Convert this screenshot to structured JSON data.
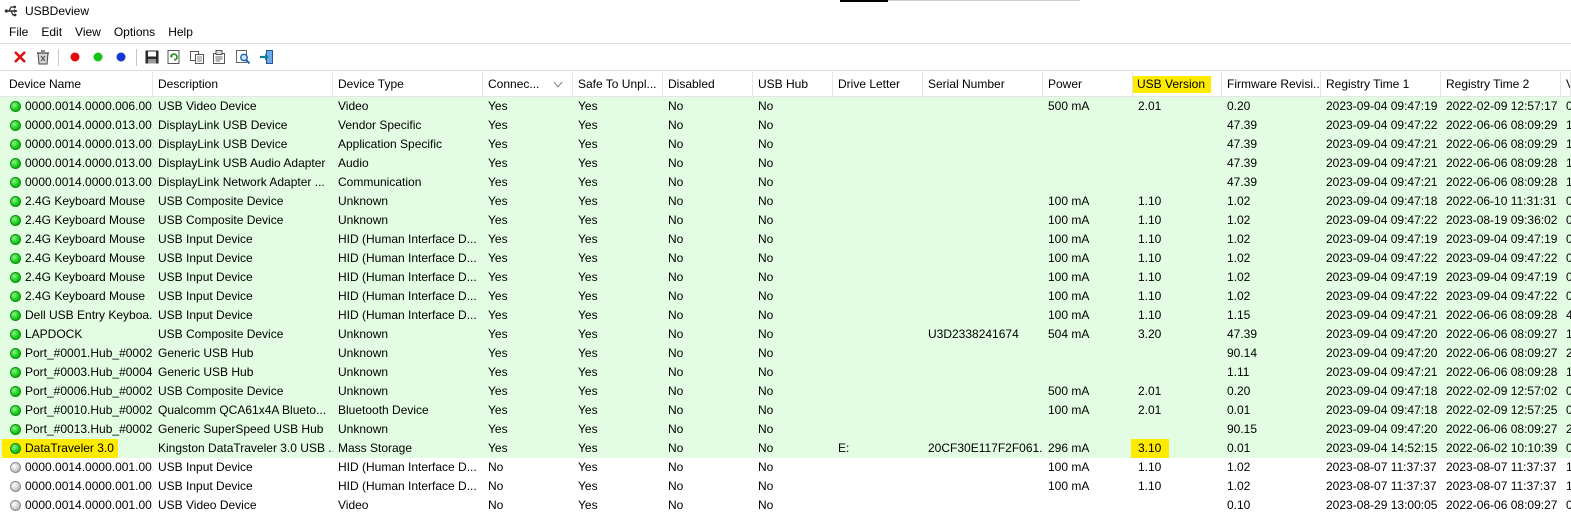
{
  "window": {
    "title": "USBDeview"
  },
  "menu": [
    "File",
    "Edit",
    "View",
    "Options",
    "Help"
  ],
  "toolbar": {
    "buttons": [
      "delete-icon",
      "uninstall-icon",
      "red-dot-icon",
      "green-dot-icon",
      "blue-dot-icon",
      "save-icon",
      "refresh-icon",
      "copy-icon",
      "properties-icon",
      "find-icon",
      "exit-icon"
    ]
  },
  "columns": [
    "Device Name",
    "Description",
    "Device Type",
    "Connec...",
    "Safe To Unpl...",
    "Disabled",
    "USB Hub",
    "Drive Letter",
    "Serial Number",
    "Power",
    "USB Version",
    "Firmware Revisi...",
    "Registry Time 1",
    "Registry Time 2",
    "V"
  ],
  "highlight_color": "#ffeb00",
  "connected_row_color": "#e2fde2",
  "rows": [
    {
      "status": "connected",
      "cells": [
        "0000.0014.0000.006.00...",
        "USB Video Device",
        "Video",
        "Yes",
        "Yes",
        "No",
        "No",
        "",
        "",
        "500 mA",
        "2.01",
        "0.20",
        "2023-09-04 09:47:19",
        "2022-02-09 12:57:17",
        "0"
      ]
    },
    {
      "status": "connected",
      "cells": [
        "0000.0014.0000.013.00...",
        "DisplayLink USB Device",
        "Vendor Specific",
        "Yes",
        "Yes",
        "No",
        "No",
        "",
        "",
        "",
        "",
        "47.39",
        "2023-09-04 09:47:22",
        "2022-06-06 08:09:29",
        "1"
      ]
    },
    {
      "status": "connected",
      "cells": [
        "0000.0014.0000.013.00...",
        "DisplayLink USB Device",
        "Application Specific",
        "Yes",
        "Yes",
        "No",
        "No",
        "",
        "",
        "",
        "",
        "47.39",
        "2023-09-04 09:47:21",
        "2022-06-06 08:09:29",
        "1"
      ]
    },
    {
      "status": "connected",
      "cells": [
        "0000.0014.0000.013.00...",
        "DisplayLink USB Audio Adapter",
        "Audio",
        "Yes",
        "Yes",
        "No",
        "No",
        "",
        "",
        "",
        "",
        "47.39",
        "2023-09-04 09:47:21",
        "2022-06-06 08:09:28",
        "1"
      ]
    },
    {
      "status": "connected",
      "cells": [
        "0000.0014.0000.013.00...",
        "DisplayLink Network Adapter ...",
        "Communication",
        "Yes",
        "Yes",
        "No",
        "No",
        "",
        "",
        "",
        "",
        "47.39",
        "2023-09-04 09:47:21",
        "2022-06-06 08:09:28",
        "1"
      ]
    },
    {
      "status": "connected",
      "cells": [
        "2.4G Keyboard Mouse",
        "USB Composite Device",
        "Unknown",
        "Yes",
        "Yes",
        "No",
        "No",
        "",
        "",
        "100 mA",
        "1.10",
        "1.02",
        "2023-09-04 09:47:18",
        "2022-06-10 11:31:31",
        "0"
      ]
    },
    {
      "status": "connected",
      "cells": [
        "2.4G Keyboard Mouse",
        "USB Composite Device",
        "Unknown",
        "Yes",
        "Yes",
        "No",
        "No",
        "",
        "",
        "100 mA",
        "1.10",
        "1.02",
        "2023-09-04 09:47:22",
        "2023-08-19 09:36:02",
        "0"
      ]
    },
    {
      "status": "connected",
      "cells": [
        "2.4G Keyboard Mouse",
        "USB Input Device",
        "HID (Human Interface D...",
        "Yes",
        "Yes",
        "No",
        "No",
        "",
        "",
        "100 mA",
        "1.10",
        "1.02",
        "2023-09-04 09:47:19",
        "2023-09-04 09:47:19",
        "0"
      ]
    },
    {
      "status": "connected",
      "cells": [
        "2.4G Keyboard Mouse",
        "USB Input Device",
        "HID (Human Interface D...",
        "Yes",
        "Yes",
        "No",
        "No",
        "",
        "",
        "100 mA",
        "1.10",
        "1.02",
        "2023-09-04 09:47:22",
        "2023-09-04 09:47:22",
        "0"
      ]
    },
    {
      "status": "connected",
      "cells": [
        "2.4G Keyboard Mouse",
        "USB Input Device",
        "HID (Human Interface D...",
        "Yes",
        "Yes",
        "No",
        "No",
        "",
        "",
        "100 mA",
        "1.10",
        "1.02",
        "2023-09-04 09:47:19",
        "2023-09-04 09:47:19",
        "0"
      ]
    },
    {
      "status": "connected",
      "cells": [
        "2.4G Keyboard Mouse",
        "USB Input Device",
        "HID (Human Interface D...",
        "Yes",
        "Yes",
        "No",
        "No",
        "",
        "",
        "100 mA",
        "1.10",
        "1.02",
        "2023-09-04 09:47:22",
        "2023-09-04 09:47:22",
        "0"
      ]
    },
    {
      "status": "connected",
      "cells": [
        "Dell USB Entry Keyboa...",
        "USB Input Device",
        "HID (Human Interface D...",
        "Yes",
        "Yes",
        "No",
        "No",
        "",
        "",
        "100 mA",
        "1.10",
        "1.15",
        "2023-09-04 09:47:21",
        "2022-06-06 08:09:28",
        "4"
      ]
    },
    {
      "status": "connected",
      "cells": [
        "LAPDOCK",
        "USB Composite Device",
        "Unknown",
        "Yes",
        "Yes",
        "No",
        "No",
        "",
        "U3D2338241674",
        "504 mA",
        "3.20",
        "47.39",
        "2023-09-04 09:47:20",
        "2022-06-06 08:09:27",
        "1"
      ]
    },
    {
      "status": "connected",
      "cells": [
        "Port_#0001.Hub_#0002",
        "Generic USB Hub",
        "Unknown",
        "Yes",
        "Yes",
        "No",
        "No",
        "",
        "",
        "",
        "",
        "90.14",
        "2023-09-04 09:47:20",
        "2022-06-06 08:09:27",
        "2"
      ]
    },
    {
      "status": "connected",
      "cells": [
        "Port_#0003.Hub_#0004",
        "Generic USB Hub",
        "Unknown",
        "Yes",
        "Yes",
        "No",
        "No",
        "",
        "",
        "",
        "",
        "1.11",
        "2023-09-04 09:47:21",
        "2022-06-06 08:09:28",
        "1"
      ]
    },
    {
      "status": "connected",
      "cells": [
        "Port_#0006.Hub_#0002",
        "USB Composite Device",
        "Unknown",
        "Yes",
        "Yes",
        "No",
        "No",
        "",
        "",
        "500 mA",
        "2.01",
        "0.20",
        "2023-09-04 09:47:18",
        "2022-02-09 12:57:02",
        "0"
      ]
    },
    {
      "status": "connected",
      "cells": [
        "Port_#0010.Hub_#0002",
        "Qualcomm QCA61x4A Blueto...",
        "Bluetooth Device",
        "Yes",
        "Yes",
        "No",
        "No",
        "",
        "",
        "100 mA",
        "2.01",
        "0.01",
        "2023-09-04 09:47:18",
        "2022-02-09 12:57:25",
        "0"
      ]
    },
    {
      "status": "connected",
      "cells": [
        "Port_#0013.Hub_#0002",
        "Generic SuperSpeed USB Hub",
        "Unknown",
        "Yes",
        "Yes",
        "No",
        "No",
        "",
        "",
        "",
        "",
        "90.15",
        "2023-09-04 09:47:20",
        "2022-06-06 08:09:27",
        "2"
      ]
    },
    {
      "status": "connected",
      "highlight": true,
      "cells": [
        "DataTraveler 3.0",
        "Kingston DataTraveler 3.0 USB ...",
        "Mass Storage",
        "Yes",
        "Yes",
        "No",
        "No",
        "E:",
        "20CF30E117F2F061...",
        "296 mA",
        "3.10",
        "0.01",
        "2023-09-04 14:52:15",
        "2022-06-02 10:10:39",
        "0"
      ]
    },
    {
      "status": "disconnected",
      "cells": [
        "0000.0014.0000.001.00...",
        "USB Input Device",
        "HID (Human Interface D...",
        "No",
        "Yes",
        "No",
        "No",
        "",
        "",
        "100 mA",
        "1.10",
        "1.02",
        "2023-08-07 11:37:37",
        "2023-08-07 11:37:37",
        "1"
      ]
    },
    {
      "status": "disconnected",
      "cells": [
        "0000.0014.0000.001.00...",
        "USB Input Device",
        "HID (Human Interface D...",
        "No",
        "Yes",
        "No",
        "No",
        "",
        "",
        "100 mA",
        "1.10",
        "1.02",
        "2023-08-07 11:37:37",
        "2023-08-07 11:37:37",
        "1"
      ]
    },
    {
      "status": "disconnected",
      "cells": [
        "0000.0014.0000.001.00...",
        "USB Video Device",
        "Video",
        "No",
        "Yes",
        "No",
        "No",
        "",
        "",
        "",
        "",
        "0.10",
        "2023-08-29 13:00:05",
        "2022-06-06 08:09:27",
        "0"
      ]
    }
  ]
}
